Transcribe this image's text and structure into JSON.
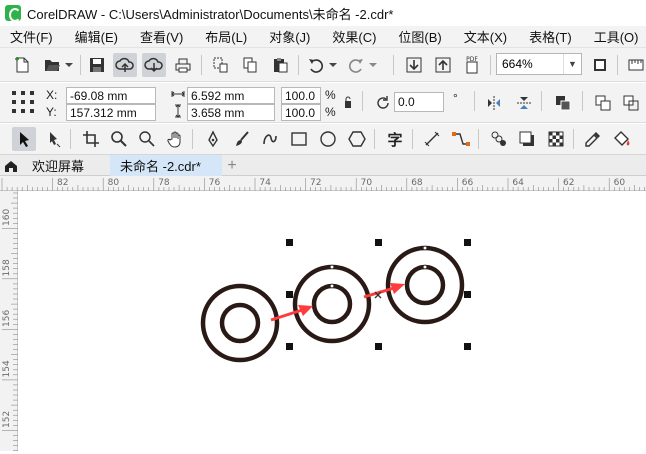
{
  "window": {
    "title": "CorelDRAW - C:\\Users\\Administrator\\Documents\\未命名 -2.cdr*"
  },
  "menu": {
    "items": [
      "文件(F)",
      "编辑(E)",
      "查看(V)",
      "布局(L)",
      "对象(J)",
      "效果(C)",
      "位图(B)",
      "文本(X)",
      "表格(T)",
      "工具(O)"
    ]
  },
  "toolbar": {
    "zoom_value": "664%",
    "pdf_label": "PDF"
  },
  "properties": {
    "x_label": "X:",
    "x_value": "-69.08 mm",
    "y_label": "Y:",
    "y_value": "157.312 mm",
    "width_value": "6.592 mm",
    "height_value": "3.658 mm",
    "scale_x": "100.0",
    "scale_y": "100.0",
    "percent_unit": "%",
    "rotation_value": "0.0",
    "degree_unit": "°"
  },
  "toolbox": {
    "text_tool_glyph": "字"
  },
  "tabs": {
    "welcome": "欢迎屏幕",
    "document": "未命名 -2.cdr*",
    "add": "+"
  },
  "rulers": {
    "horizontal_ticks": [
      "82",
      "80",
      "78",
      "76",
      "74",
      "72",
      "70",
      "68",
      "66",
      "64",
      "62",
      "60"
    ],
    "vertical_ticks": [
      "160",
      "158",
      "156",
      "154",
      "152"
    ]
  },
  "colors": {
    "arrow": "#ff3b3b",
    "ring": "#2a1a16",
    "active_tab": "#d4e6f7",
    "app_green": "#2db34a"
  }
}
